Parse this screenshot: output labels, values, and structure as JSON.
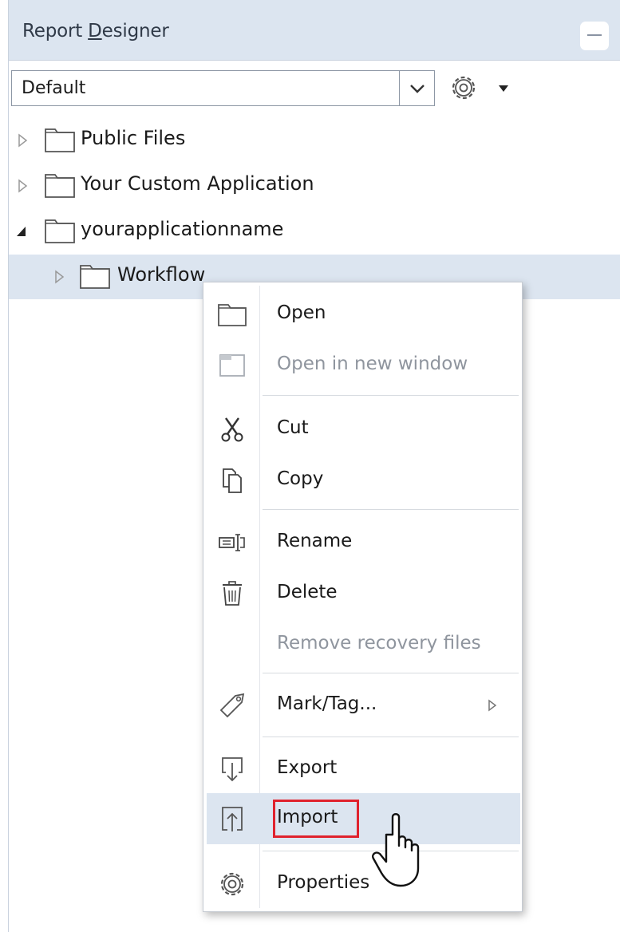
{
  "panel": {
    "title_pre": "Report ",
    "title_underlined": "D",
    "title_post": "esigner"
  },
  "combo": {
    "value": "Default"
  },
  "tree": [
    {
      "label": "Public Files",
      "expanded": false
    },
    {
      "label": "Your Custom Application",
      "expanded": false
    },
    {
      "label": "yourapplicationname",
      "expanded": true
    },
    {
      "label": "Workflow",
      "expanded": false,
      "selected": true
    }
  ],
  "context_menu": {
    "items": [
      {
        "label": "Open",
        "icon": "folder-icon",
        "enabled": true
      },
      {
        "label": "Open in new window",
        "icon": "window-icon",
        "enabled": false
      },
      {
        "label": "Cut",
        "icon": "scissors-icon",
        "enabled": true
      },
      {
        "label": "Copy",
        "icon": "copy-icon",
        "enabled": true
      },
      {
        "label": "Rename",
        "icon": "rename-icon",
        "enabled": true
      },
      {
        "label": "Delete",
        "icon": "trash-icon",
        "enabled": true
      },
      {
        "label": "Remove recovery files",
        "icon": "",
        "enabled": false
      },
      {
        "label": "Mark/Tag...",
        "icon": "tag-icon",
        "enabled": true,
        "submenu": true
      },
      {
        "label": "Export",
        "icon": "export-icon",
        "enabled": true
      },
      {
        "label": "Import",
        "icon": "import-icon",
        "enabled": true,
        "hovered": true
      },
      {
        "label": "Properties",
        "icon": "gear-icon",
        "enabled": true
      }
    ]
  },
  "colors": {
    "header_bg": "#dce5f0",
    "selection_bg": "#dce5f0",
    "highlight_border": "#e0222d",
    "disabled_text": "#8f959e"
  }
}
